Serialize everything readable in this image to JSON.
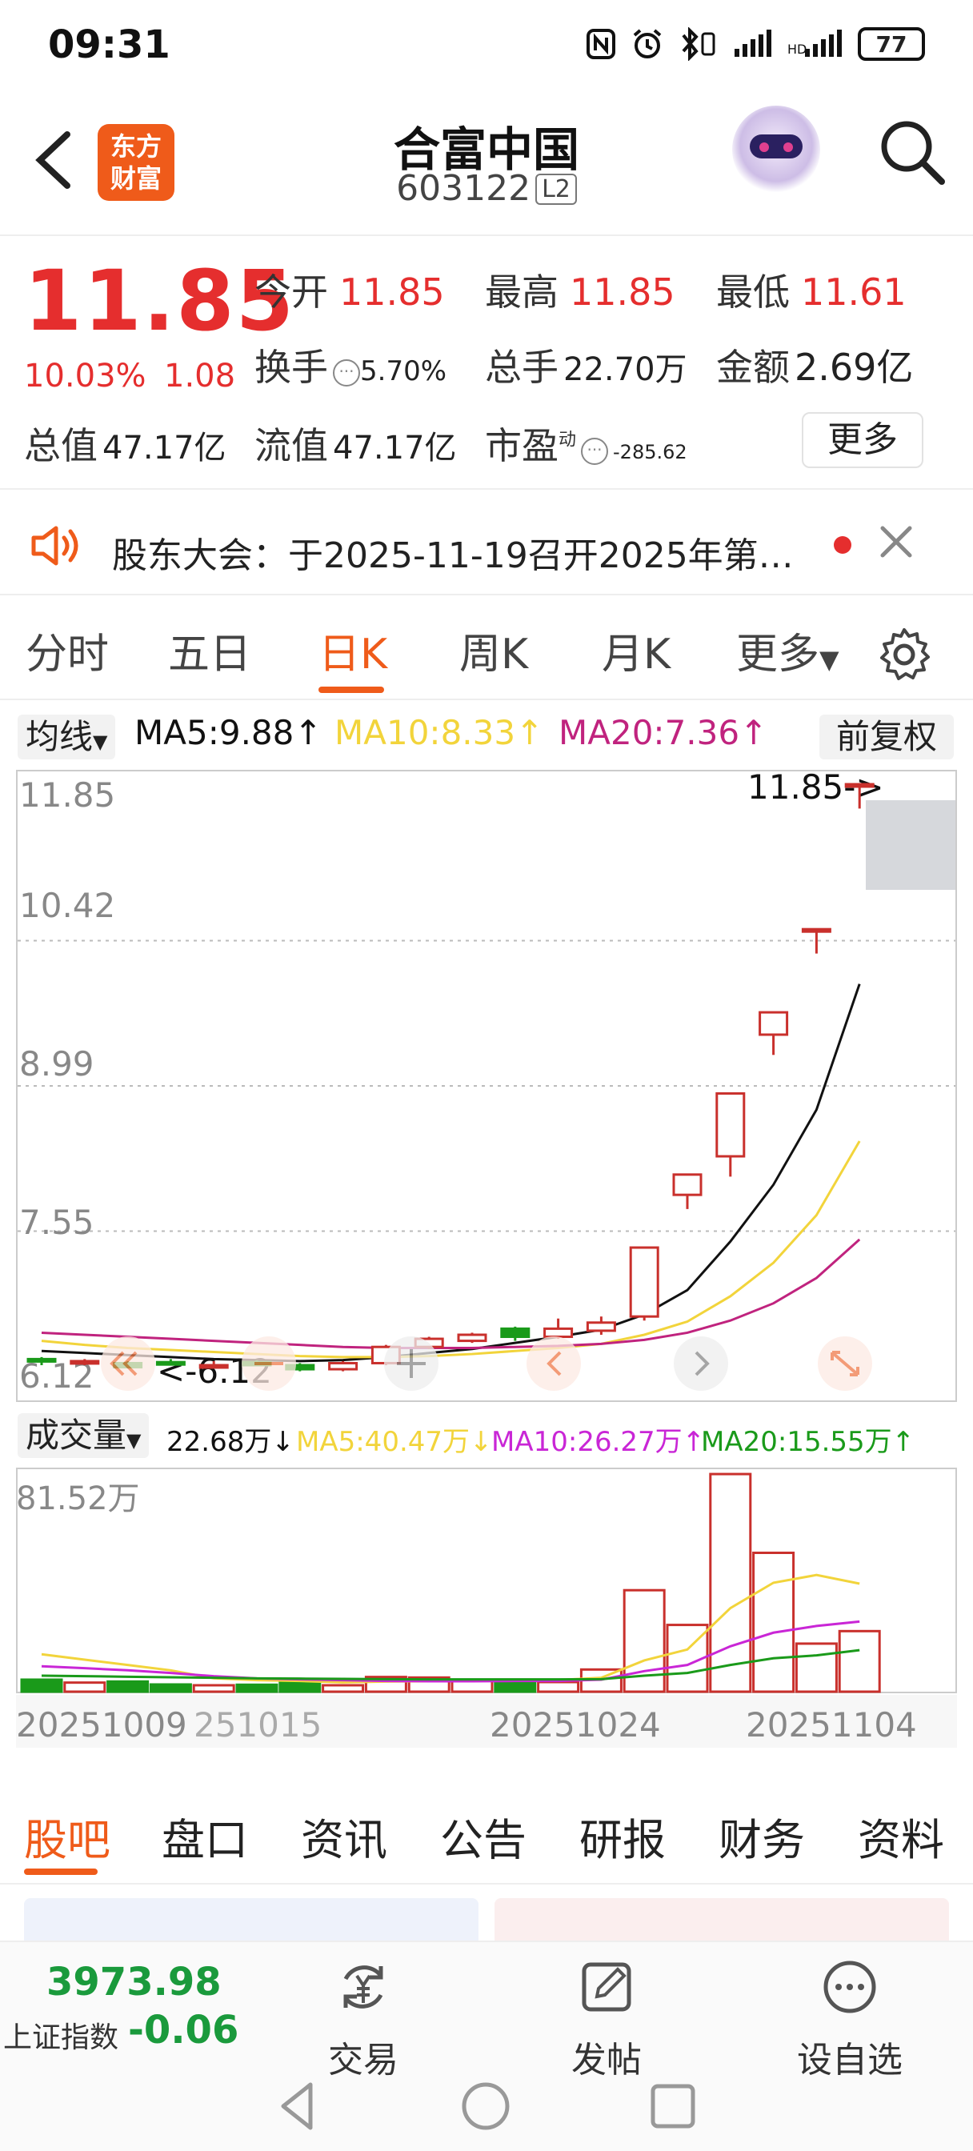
{
  "status_bar": {
    "time": "09:31",
    "battery": "77"
  },
  "header": {
    "logo_text": [
      "东方",
      "财富"
    ],
    "stock_name": "合富中国",
    "stock_code": "603122",
    "level_badge": "L2"
  },
  "quote": {
    "price": "11.85",
    "change_pct": "10.03%",
    "change": "1.08",
    "open_label": "今开",
    "open": "11.85",
    "high_label": "最高",
    "high": "11.85",
    "low_label": "最低",
    "low": "11.61",
    "turnover_label": "换手",
    "turnover": "5.70%",
    "volume_label": "总手",
    "volume": "22.70万",
    "amount_label": "金额",
    "amount": "2.69亿",
    "total_cap_label": "总值",
    "total_cap": "47.17亿",
    "float_cap_label": "流值",
    "float_cap": "47.17亿",
    "pe_label": "市盈",
    "pe_sup": "动",
    "pe": "-285.62",
    "more_label": "更多"
  },
  "notice": {
    "text": "股东大会：于2025-11-19召开2025年第…"
  },
  "chart_tabs": [
    "分时",
    "五日",
    "日K",
    "周K",
    "月K",
    "更多"
  ],
  "active_chart_tab": "日K",
  "ma_bar": {
    "mode_label": "均线",
    "ma5": "MA5:9.88↑",
    "ma10": "MA10:8.33↑",
    "ma20": "MA20:7.36↑",
    "adjust_label": "前复权",
    "colors": {
      "ma5": "#111111",
      "ma10": "#f2d43b",
      "ma20": "#c0237e"
    }
  },
  "kline_axis": {
    "labels": [
      "11.85",
      "10.42",
      "8.99",
      "7.55",
      "6.12"
    ],
    "max_marker": "11.85->",
    "min_marker": "<-6.12"
  },
  "volume_bar": {
    "label": "成交量",
    "vol": "22.68万↓",
    "ma5": "MA5:40.47万↓",
    "ma10": "MA10:26.27万↑",
    "ma20": "MA20:15.55万↑",
    "colors": {
      "ma5": "#f2d43b",
      "ma10": "#c926d6",
      "ma20": "#1a9a1a"
    }
  },
  "volume_axis": {
    "max_label": "81.52万"
  },
  "date_labels": [
    "20251009",
    "251015",
    "20251024",
    "20251104"
  ],
  "bottom_tabs": [
    "股吧",
    "盘口",
    "资讯",
    "公告",
    "研报",
    "财务",
    "资料"
  ],
  "active_bottom_tab": "股吧",
  "footer": {
    "index_value": "3973.98",
    "index_name": "上证指数",
    "index_change": "-0.06",
    "trade_label": "交易",
    "post_label": "发帖",
    "watch_label": "设自选"
  },
  "chart_data": [
    {
      "type": "candlestick",
      "title": "日K",
      "ylim": [
        6.12,
        11.85
      ],
      "candles": [
        {
          "o": 6.18,
          "c": 6.18,
          "h": 6.2,
          "l": 6.12,
          "dir": "down"
        },
        {
          "o": 6.16,
          "c": 6.14,
          "h": 6.18,
          "l": 6.12,
          "dir": "up"
        },
        {
          "o": 6.14,
          "c": 6.1,
          "h": 6.16,
          "l": 6.1,
          "dir": "down"
        },
        {
          "o": 6.15,
          "c": 6.13,
          "h": 6.18,
          "l": 6.12,
          "dir": "down"
        },
        {
          "o": 6.12,
          "c": 6.12,
          "h": 6.16,
          "l": 6.12,
          "dir": "up"
        },
        {
          "o": 6.12,
          "c": 6.15,
          "h": 6.17,
          "l": 6.12,
          "dir": "down"
        },
        {
          "o": 6.12,
          "c": 6.08,
          "h": 6.14,
          "l": 6.06,
          "dir": "down"
        },
        {
          "o": 6.08,
          "c": 6.14,
          "h": 6.16,
          "l": 6.06,
          "dir": "up"
        },
        {
          "o": 6.14,
          "c": 6.3,
          "h": 6.32,
          "l": 6.12,
          "dir": "up"
        },
        {
          "o": 6.3,
          "c": 6.38,
          "h": 6.4,
          "l": 6.28,
          "dir": "up"
        },
        {
          "o": 6.36,
          "c": 6.42,
          "h": 6.44,
          "l": 6.34,
          "dir": "up"
        },
        {
          "o": 6.48,
          "c": 6.4,
          "h": 6.5,
          "l": 6.36,
          "dir": "down"
        },
        {
          "o": 6.4,
          "c": 6.48,
          "h": 6.58,
          "l": 6.38,
          "dir": "up"
        },
        {
          "o": 6.46,
          "c": 6.54,
          "h": 6.6,
          "l": 6.42,
          "dir": "up"
        },
        {
          "o": 6.6,
          "c": 7.28,
          "h": 7.28,
          "l": 6.56,
          "dir": "up"
        },
        {
          "o": 7.8,
          "c": 8.0,
          "h": 8.0,
          "l": 7.66,
          "dir": "up"
        },
        {
          "o": 8.18,
          "c": 8.8,
          "h": 8.8,
          "l": 7.98,
          "dir": "up"
        },
        {
          "o": 9.38,
          "c": 9.6,
          "h": 9.6,
          "l": 9.18,
          "dir": "up"
        },
        {
          "o": 10.42,
          "c": 10.42,
          "h": 10.42,
          "l": 10.18,
          "dir": "up"
        },
        {
          "o": 11.85,
          "c": 11.85,
          "h": 11.85,
          "l": 11.61,
          "dir": "up"
        }
      ],
      "series": [
        {
          "name": "MA5",
          "values": [
            6.26,
            6.24,
            6.22,
            6.2,
            6.18,
            6.17,
            6.16,
            6.17,
            6.2,
            6.24,
            6.28,
            6.34,
            6.4,
            6.47,
            6.62,
            6.86,
            7.34,
            7.9,
            8.64,
            9.88
          ]
        },
        {
          "name": "MA10",
          "values": [
            6.36,
            6.32,
            6.29,
            6.27,
            6.25,
            6.23,
            6.21,
            6.2,
            6.2,
            6.21,
            6.23,
            6.26,
            6.29,
            6.33,
            6.42,
            6.55,
            6.8,
            7.13,
            7.6,
            8.33
          ]
        },
        {
          "name": "MA20",
          "values": [
            6.44,
            6.42,
            6.4,
            6.38,
            6.36,
            6.34,
            6.32,
            6.3,
            6.29,
            6.29,
            6.29,
            6.3,
            6.31,
            6.33,
            6.37,
            6.44,
            6.56,
            6.73,
            6.98,
            7.36
          ]
        }
      ]
    },
    {
      "type": "bar",
      "title": "成交量",
      "ylim": [
        0,
        81.52
      ],
      "values": [
        4.5,
        3.4,
        3.8,
        2.7,
        2.4,
        2.6,
        3.3,
        2.4,
        5.5,
        5.3,
        4.2,
        4.5,
        3.6,
        8.3,
        38.0,
        25.0,
        81.5,
        52.0,
        18.0,
        22.68
      ],
      "directions": [
        "down",
        "up",
        "down",
        "down",
        "up",
        "down",
        "down",
        "up",
        "up",
        "up",
        "up",
        "down",
        "up",
        "up",
        "up",
        "up",
        "up",
        "up",
        "up",
        "up"
      ],
      "series": [
        {
          "name": "MA5",
          "values": [
            14.0,
            12.0,
            10.0,
            8.0,
            5.0,
            4.3,
            4.0,
            3.5,
            3.8,
            3.9,
            4.0,
            4.3,
            4.4,
            5.2,
            11.7,
            15.8,
            31.3,
            40.8,
            43.7,
            40.47
          ]
        },
        {
          "name": "MA10",
          "values": [
            9.5,
            8.8,
            8.0,
            7.0,
            5.8,
            5.0,
            4.6,
            4.3,
            4.0,
            3.9,
            3.9,
            4.0,
            4.0,
            4.5,
            7.7,
            10.0,
            17.0,
            22.1,
            24.6,
            26.27
          ]
        },
        {
          "name": "MA20",
          "values": [
            6.0,
            5.8,
            5.6,
            5.4,
            5.2,
            5.0,
            4.9,
            4.8,
            4.7,
            4.6,
            4.6,
            4.6,
            4.6,
            4.7,
            6.0,
            7.0,
            10.0,
            12.5,
            13.6,
            15.55
          ]
        }
      ]
    }
  ]
}
